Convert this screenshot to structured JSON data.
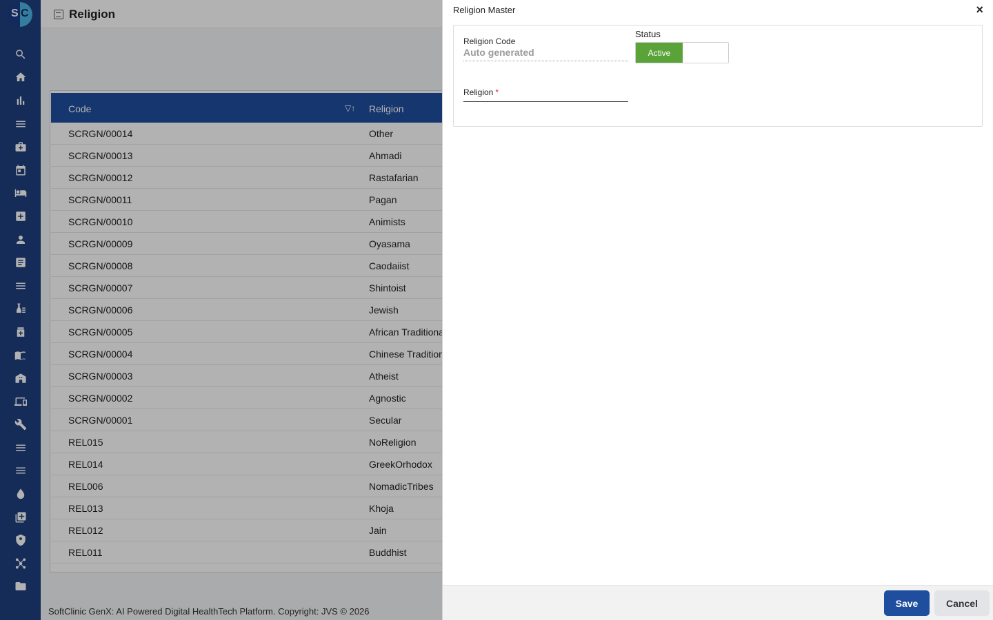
{
  "app": {
    "logo_text_left": "S",
    "logo_text_right": "C"
  },
  "header": {
    "title": "Religion"
  },
  "sidebar": {
    "icons": [
      "search-icon",
      "home-icon",
      "bar-chart-icon",
      "menu-icon",
      "medical-bag-icon",
      "calendar-icon",
      "bed-icon",
      "plus-box-icon",
      "person-icon",
      "receipt-icon",
      "list-icon",
      "lab-icon",
      "medicine-box-icon",
      "book-icon",
      "building-icon",
      "devices-icon",
      "wrench-icon",
      "menu-icon",
      "menu-icon",
      "drop-icon",
      "add-library-icon",
      "shield-icon",
      "hub-icon",
      "folder-icon"
    ]
  },
  "grid": {
    "columns": {
      "code": "Code",
      "religion": "Religion"
    },
    "rows": [
      {
        "code": "SCRGN/00014",
        "religion": "Other"
      },
      {
        "code": "SCRGN/00013",
        "religion": "Ahmadi"
      },
      {
        "code": "SCRGN/00012",
        "religion": "Rastafarian"
      },
      {
        "code": "SCRGN/00011",
        "religion": "Pagan"
      },
      {
        "code": "SCRGN/00010",
        "religion": "Animists"
      },
      {
        "code": "SCRGN/00009",
        "religion": "Oyasama"
      },
      {
        "code": "SCRGN/00008",
        "religion": "Caodaiist"
      },
      {
        "code": "SCRGN/00007",
        "religion": "Shintoist"
      },
      {
        "code": "SCRGN/00006",
        "religion": "Jewish"
      },
      {
        "code": "SCRGN/00005",
        "religion": "African Traditiona"
      },
      {
        "code": "SCRGN/00004",
        "religion": "Chinese Tradition"
      },
      {
        "code": "SCRGN/00003",
        "religion": "Atheist"
      },
      {
        "code": "SCRGN/00002",
        "religion": "Agnostic"
      },
      {
        "code": "SCRGN/00001",
        "religion": "Secular"
      },
      {
        "code": "REL015",
        "religion": "NoReligion"
      },
      {
        "code": "REL014",
        "religion": "GreekOrhodox"
      },
      {
        "code": "REL006",
        "religion": "NomadicTribes"
      },
      {
        "code": "REL013",
        "religion": "Khoja"
      },
      {
        "code": "REL012",
        "religion": "Jain"
      },
      {
        "code": "REL011",
        "religion": "Buddhist"
      }
    ]
  },
  "footer": {
    "text": "SoftClinic GenX: AI Powered Digital HealthTech Platform. Copyright: JVS © 2026"
  },
  "drawer": {
    "title": "Religion Master",
    "close_label": "×",
    "religion_code_label": "Religion Code",
    "religion_code_value": "Auto generated",
    "status_label": "Status",
    "status_active_label": "Active",
    "religion_label": "Religion",
    "required_mark": "*",
    "religion_value": "",
    "save_label": "Save",
    "cancel_label": "Cancel"
  },
  "colors": {
    "sidebar": "#1f3f7f",
    "grid_header": "#1f4e9e",
    "active_toggle": "#5aa339",
    "save_button": "#1f4e9e"
  }
}
